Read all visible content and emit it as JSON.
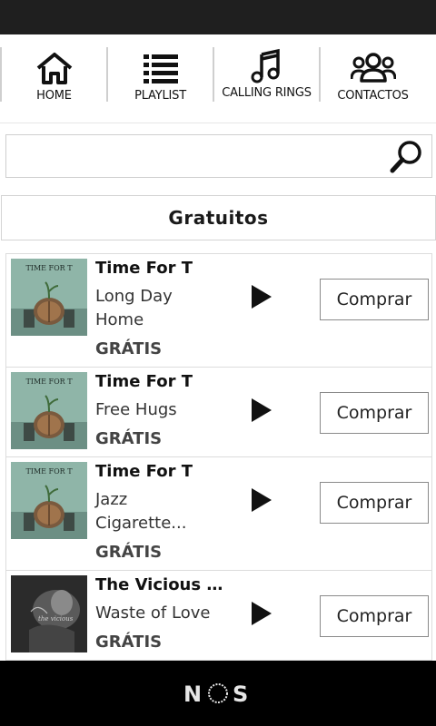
{
  "nav": {
    "items": [
      {
        "label": "HOME",
        "icon": "home-icon"
      },
      {
        "label": "PLAYLIST",
        "icon": "list-icon"
      },
      {
        "label": "CALLING RINGS",
        "icon": "music-note-icon"
      },
      {
        "label": "CONTACTOS",
        "icon": "people-icon"
      }
    ]
  },
  "search": {
    "value": "",
    "placeholder": ""
  },
  "section": {
    "title": "Gratuitos"
  },
  "tracks": [
    {
      "artist": "Time For T",
      "title": "Long Day Home",
      "price": "GRÁTIS",
      "buy_label": "Comprar",
      "cover": "album-cover-brain"
    },
    {
      "artist": "Time For T",
      "title": "Free Hugs",
      "price": "GRÁTIS",
      "buy_label": "Comprar",
      "cover": "album-cover-brain"
    },
    {
      "artist": "Time For T",
      "title": "Jazz Cigarette...",
      "price": "GRÁTIS",
      "buy_label": "Comprar",
      "cover": "album-cover-brain"
    },
    {
      "artist": "The Vicious Fi...",
      "title": "Waste of Love",
      "price": "GRÁTIS",
      "buy_label": "Comprar",
      "cover": "album-cover-grayscale"
    }
  ],
  "footer": {
    "brand": "NOS"
  },
  "colors": {
    "statusbar": "#1f1f1f",
    "footer": "#000000",
    "border": "#dcdcdc"
  }
}
